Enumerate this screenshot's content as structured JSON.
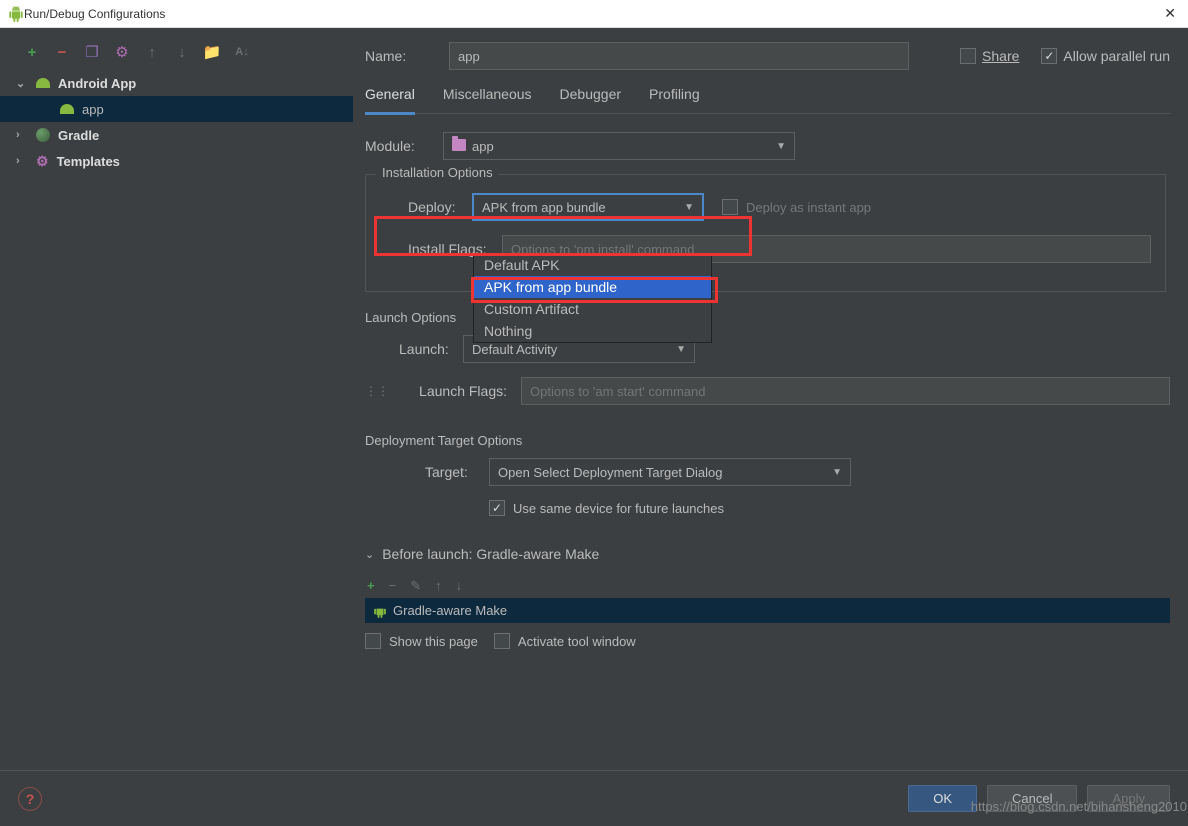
{
  "window": {
    "title": "Run/Debug Configurations"
  },
  "sidebar": {
    "items": [
      {
        "label": "Android App",
        "expanded": true,
        "bold": true,
        "icon": "android"
      },
      {
        "label": "app",
        "child": true,
        "selected": true,
        "icon": "android"
      },
      {
        "label": "Gradle",
        "expanded": false,
        "bold": true,
        "icon": "gradle"
      },
      {
        "label": "Templates",
        "expanded": false,
        "bold": true,
        "icon": "gear"
      }
    ]
  },
  "header": {
    "name_label": "Name:",
    "name_value": "app",
    "share_label": "Share",
    "parallel_label": "Allow parallel run"
  },
  "tabs": [
    "General",
    "Miscellaneous",
    "Debugger",
    "Profiling"
  ],
  "module": {
    "label": "Module:",
    "value": "app"
  },
  "installation": {
    "legend": "Installation Options",
    "deploy_label": "Deploy:",
    "deploy_value": "APK from app bundle",
    "deploy_options": [
      "Default APK",
      "APK from app bundle",
      "Custom Artifact",
      "Nothing"
    ],
    "instant_label": "Deploy as instant app",
    "install_flags_label": "Install Flags:",
    "install_flags_placeholder": "Options to 'pm install' command"
  },
  "launch": {
    "legend": "Launch Options",
    "launch_label": "Launch:",
    "launch_value": "Default Activity",
    "flags_label": "Launch Flags:",
    "flags_placeholder": "Options to 'am start' command"
  },
  "deployment": {
    "legend": "Deployment Target Options",
    "target_label": "Target:",
    "target_value": "Open Select Deployment Target Dialog",
    "same_device_label": "Use same device for future launches"
  },
  "before_launch": {
    "header": "Before launch: Gradle-aware Make",
    "item": "Gradle-aware Make",
    "show_page_label": "Show this page",
    "activate_label": "Activate tool window"
  },
  "footer": {
    "ok": "OK",
    "cancel": "Cancel",
    "apply": "Apply"
  },
  "watermark": "https://blog.csdn.net/bihansheng2010"
}
